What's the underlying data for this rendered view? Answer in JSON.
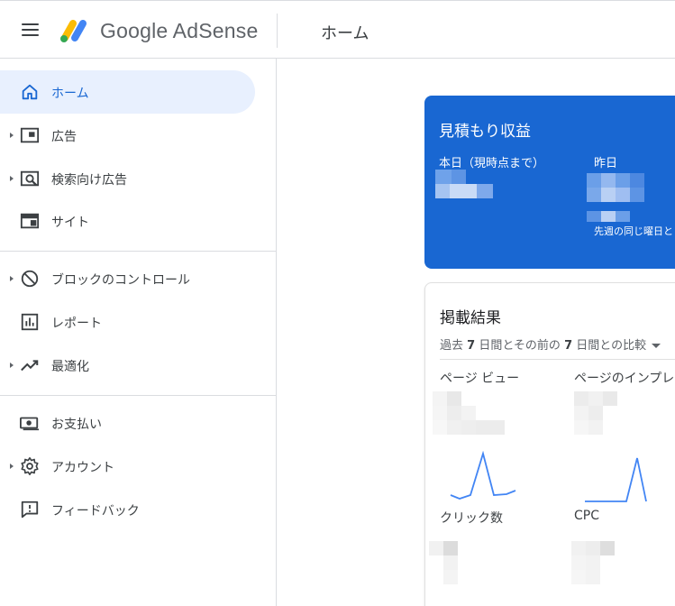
{
  "header": {
    "brand": "Google AdSense",
    "page_title": "ホーム"
  },
  "sidebar": {
    "items": [
      {
        "label": "ホーム",
        "icon": "home-icon",
        "active": true,
        "expandable": false
      },
      {
        "label": "広告",
        "icon": "ads-icon",
        "active": false,
        "expandable": true
      },
      {
        "label": "検索向け広告",
        "icon": "search-ads-icon",
        "active": false,
        "expandable": true
      },
      {
        "label": "サイト",
        "icon": "sites-icon",
        "active": false,
        "expandable": false
      },
      {
        "label": "ブロックのコントロール",
        "icon": "block-icon",
        "active": false,
        "expandable": true
      },
      {
        "label": "レポート",
        "icon": "reports-icon",
        "active": false,
        "expandable": false
      },
      {
        "label": "最適化",
        "icon": "optimization-icon",
        "active": false,
        "expandable": true
      },
      {
        "label": "お支払い",
        "icon": "payments-icon",
        "active": false,
        "expandable": false
      },
      {
        "label": "アカウント",
        "icon": "gear-icon",
        "active": false,
        "expandable": true
      },
      {
        "label": "フィードバック",
        "icon": "feedback-icon",
        "active": false,
        "expandable": false
      }
    ]
  },
  "earnings_card": {
    "title": "見積もり収益",
    "today_label": "本日（現時点まで）",
    "yesterday_label": "昨日",
    "comparison_label": "先週の同じ曜日と"
  },
  "performance_card": {
    "title": "掲載結果",
    "compare_prefix": "過去 ",
    "compare_days1": "7",
    "compare_mid": " 日間とその前の ",
    "compare_days2": "7",
    "compare_suffix": " 日間との比較",
    "metrics": {
      "pageviews": "ページ ビュー",
      "impressions": "ページのインプレッション",
      "clicks": "クリック数",
      "cpc": "CPC"
    }
  },
  "colors": {
    "accent": "#1967d2",
    "active_bg": "#e8f0fe",
    "sparkline": "#4285f4",
    "border": "#dadce0"
  }
}
